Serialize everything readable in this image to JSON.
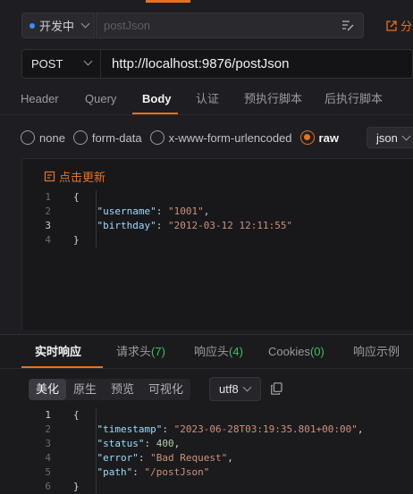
{
  "environment": {
    "label": "开发中",
    "dot_color": "#3d8bff"
  },
  "request_name": {
    "placeholder": "postJson"
  },
  "share_label": "分",
  "request": {
    "method": "POST",
    "url": "http://localhost:9876/postJson"
  },
  "tabs": [
    {
      "label": "Header"
    },
    {
      "label": "Query"
    },
    {
      "label": "Body",
      "active": true
    },
    {
      "label": "认证"
    },
    {
      "label": "预执行脚本"
    },
    {
      "label": "后执行脚本"
    }
  ],
  "body_types": [
    {
      "label": "none",
      "selected": false
    },
    {
      "label": "form-data",
      "selected": false
    },
    {
      "label": "x-www-form-urlencoded",
      "selected": false
    },
    {
      "label": "raw",
      "selected": true
    }
  ],
  "raw_format": "json",
  "refresh_label": "点击更新",
  "request_body": {
    "line_numbers": [
      "1",
      "2",
      "3",
      "4"
    ],
    "lines": [
      {
        "indent": "",
        "parts": [
          [
            "p",
            "{"
          ]
        ]
      },
      {
        "indent": "    ",
        "parts": [
          [
            "k",
            "\"username\""
          ],
          [
            "p",
            ": "
          ],
          [
            "s",
            "\"1001\""
          ],
          [
            "p",
            ","
          ]
        ]
      },
      {
        "indent": "    ",
        "parts": [
          [
            "k",
            "\"birthday\""
          ],
          [
            "p",
            ": "
          ],
          [
            "s",
            "\"2012-03-12 12:11:55\""
          ]
        ]
      },
      {
        "indent": "",
        "parts": [
          [
            "p",
            "}"
          ]
        ]
      }
    ]
  },
  "response_tabs": [
    {
      "label": "实时响应",
      "active": true
    },
    {
      "label": "请求头",
      "count": "(7)"
    },
    {
      "label": "响应头",
      "count": "(4)"
    },
    {
      "label": "Cookies",
      "count": "(0)"
    },
    {
      "label": "响应示例"
    }
  ],
  "view_modes": [
    {
      "label": "美化",
      "active": true
    },
    {
      "label": "原生"
    },
    {
      "label": "预览"
    },
    {
      "label": "可视化"
    }
  ],
  "encoding": "utf8",
  "response_body": {
    "line_numbers": [
      "1",
      "2",
      "3",
      "4",
      "5",
      "6"
    ],
    "lines": [
      {
        "indent": "",
        "parts": [
          [
            "p",
            "{"
          ]
        ]
      },
      {
        "indent": "    ",
        "parts": [
          [
            "k",
            "\"timestamp\""
          ],
          [
            "p",
            ": "
          ],
          [
            "s",
            "\"2023-06-28T03:19:35.801+00:00\""
          ],
          [
            "p",
            ","
          ]
        ]
      },
      {
        "indent": "    ",
        "parts": [
          [
            "k",
            "\"status\""
          ],
          [
            "p",
            ": "
          ],
          [
            "n",
            "400"
          ],
          [
            "p",
            ","
          ]
        ]
      },
      {
        "indent": "    ",
        "parts": [
          [
            "k",
            "\"error\""
          ],
          [
            "p",
            ": "
          ],
          [
            "s",
            "\"Bad Request\""
          ],
          [
            "p",
            ","
          ]
        ]
      },
      {
        "indent": "    ",
        "parts": [
          [
            "k",
            "\"path\""
          ],
          [
            "p",
            ": "
          ],
          [
            "s",
            "\"/postJson\""
          ]
        ]
      },
      {
        "indent": "",
        "parts": [
          [
            "p",
            "}"
          ]
        ]
      }
    ]
  },
  "accent_color": "#e8721c"
}
